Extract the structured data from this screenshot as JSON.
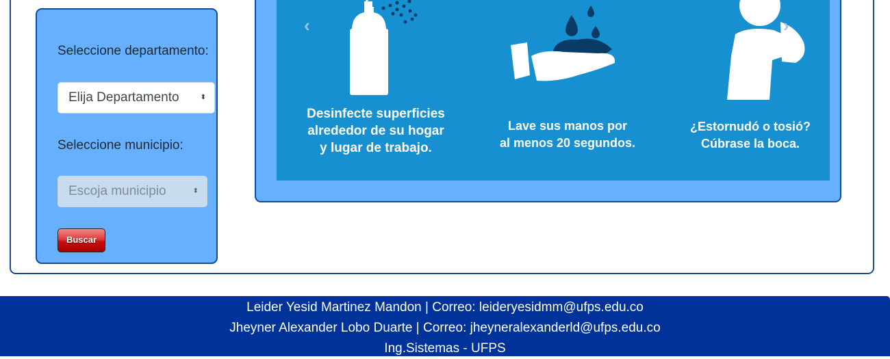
{
  "form": {
    "department_label": "Seleccione departamento:",
    "department_select_value": "Elija Departamento",
    "municipality_label": "Seleccione municipio:",
    "municipality_select_value": "Escoja municipio",
    "search_button": "Buscar"
  },
  "carousel": {
    "prev_icon": "chevron-left-icon",
    "next_icon": "chevron-right-icon",
    "captions": [
      [
        "Desinfecte superficies",
        "alrededor de su hogar",
        "y lugar de trabajo."
      ],
      [
        "Lave sus manos por",
        "al menos 20 segundos."
      ],
      [
        "¿Estornudó o tosió?",
        "Cúbrase la boca."
      ]
    ],
    "colors": {
      "slide_bg": "#1690d0",
      "panel_bg": "#66b0ff"
    }
  },
  "footer": {
    "line1": "Leider Yesid Martinez Mandon | Correo: leideryesidmm@ufps.edu.co",
    "line2": "Jheyner Alexander Lobo Duarte | Correo: jheyneralexanderld@ufps.edu.co",
    "line3": "Ing.Sistemas - UFPS",
    "bg_color": "#003399"
  }
}
